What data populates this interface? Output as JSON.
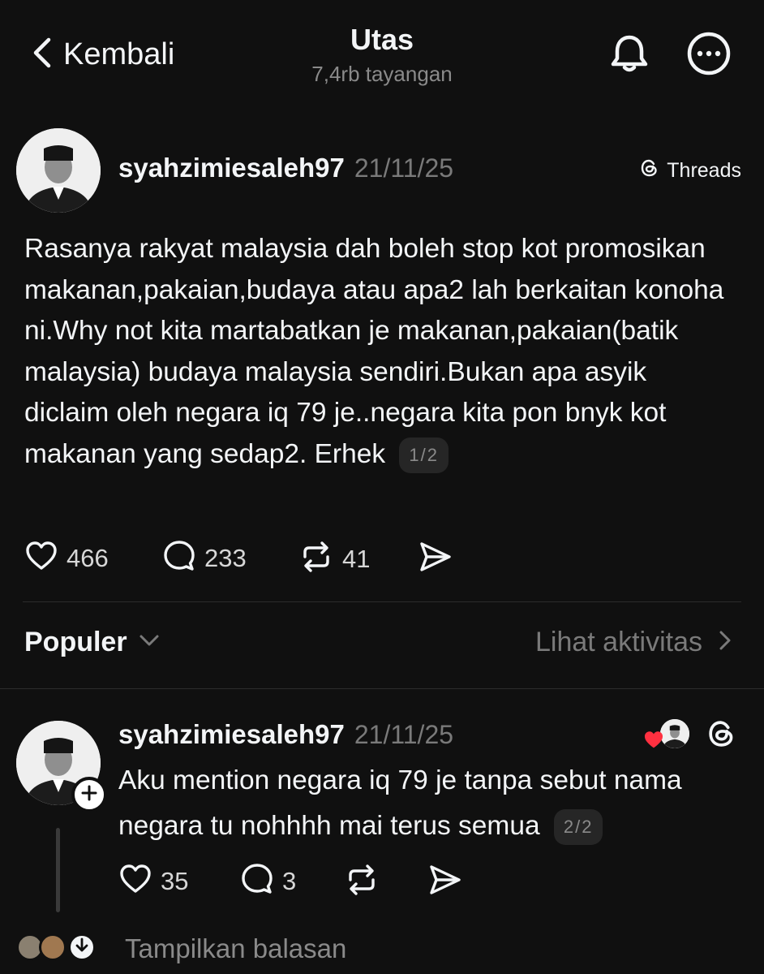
{
  "header": {
    "back_label": "Kembali",
    "title": "Utas",
    "views": "7,4rb tayangan"
  },
  "post": {
    "username": "syahzimiesaleh97",
    "timestamp": "21/11/25",
    "badge": "Threads",
    "text": "Rasanya rakyat malaysia dah boleh stop kot promosikan makanan,pakaian,budaya atau apa2 lah berkaitan konoha ni.Why not kita martabatkan je makanan,pakaian(batik malaysia) budaya malaysia sendiri.Bukan apa asyik diclaim oleh negara iq 79 je..negara kita pon bnyk kot makanan yang sedap2. Erhek",
    "pager": "1/2",
    "likes": "466",
    "replies": "233",
    "reposts": "41"
  },
  "sort": {
    "label": "Populer",
    "activity_label": "Lihat aktivitas"
  },
  "reply": {
    "username": "syahzimiesaleh97",
    "timestamp": "21/11/25",
    "text": "Aku mention negara iq 79 je tanpa sebut nama negara tu nohhhh mai terus semua",
    "pager": "2/2",
    "likes": "35",
    "replies": "3"
  },
  "footer": {
    "show_replies": "Tampilkan balasan"
  },
  "colors": {
    "background": "#101010",
    "text": "#f3f5f7",
    "muted": "#7a7a7a",
    "like_heart": "#ff3040"
  }
}
